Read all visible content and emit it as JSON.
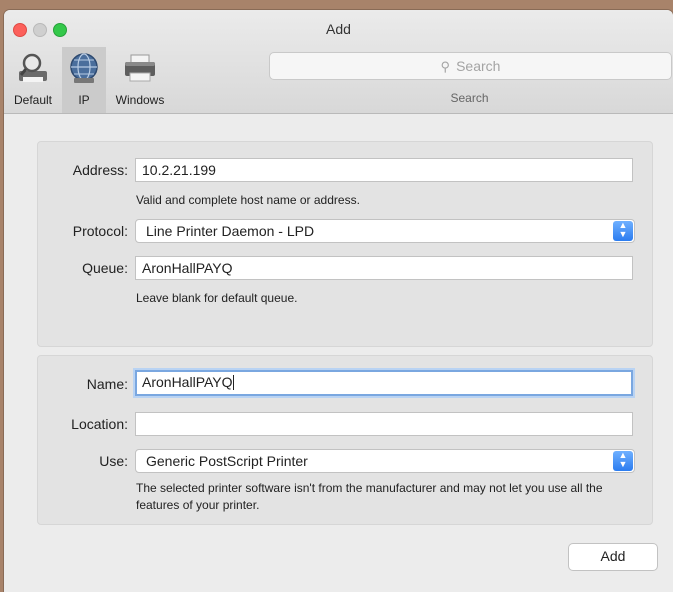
{
  "window": {
    "title": "Add"
  },
  "toolbar": {
    "items": [
      {
        "label": "Default",
        "icon": "magnifier-printer-icon",
        "selected": false
      },
      {
        "label": "IP",
        "icon": "globe-icon",
        "selected": true
      },
      {
        "label": "Windows",
        "icon": "printer-icon",
        "selected": false
      }
    ],
    "search": {
      "placeholder": "Search",
      "caption": "Search"
    }
  },
  "connection": {
    "address_label": "Address:",
    "address_value": "10.2.21.199",
    "address_hint": "Valid and complete host name or address.",
    "protocol_label": "Protocol:",
    "protocol_value": "Line Printer Daemon - LPD",
    "queue_label": "Queue:",
    "queue_value": "AronHallPAYQ",
    "queue_hint": "Leave blank for default queue."
  },
  "printer": {
    "name_label": "Name:",
    "name_value": "AronHallPAYQ",
    "location_label": "Location:",
    "location_value": "",
    "use_label": "Use:",
    "use_value": "Generic PostScript Printer",
    "use_hint": "The selected printer software isn't from the manufacturer and may not let you use all the features of your printer."
  },
  "actions": {
    "add_label": "Add"
  },
  "colors": {
    "accent": "#2b7cf0",
    "focus": "#7aa7e0",
    "close": "#fc605b",
    "zoom": "#34c84a"
  }
}
